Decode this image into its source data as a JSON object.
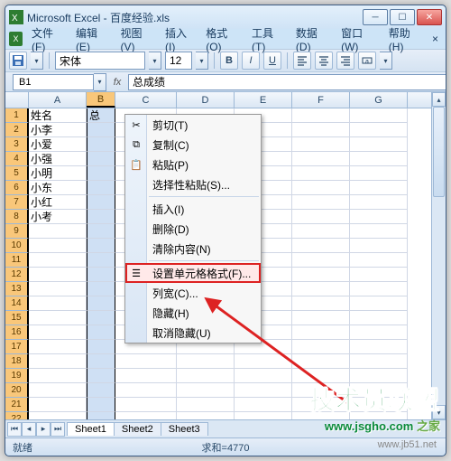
{
  "title": "Microsoft Excel - 百度经验.xls",
  "menus": {
    "file": "文件(F)",
    "edit": "编辑(E)",
    "view": "视图(V)",
    "insert": "插入(I)",
    "format": "格式(O)",
    "tools": "工具(T)",
    "data": "数据(D)",
    "window": "窗口(W)",
    "help": "帮助(H)"
  },
  "toolbar": {
    "font": "宋体",
    "size": "12"
  },
  "namebox": "B1",
  "formula": "总成绩",
  "columns": [
    "A",
    "B",
    "C",
    "D",
    "E",
    "F",
    "G"
  ],
  "rowcount": 23,
  "dataA": [
    "姓名",
    "小李",
    "小爱",
    "小强",
    "小明",
    "小东",
    "小红",
    "小考"
  ],
  "dataB_first": "总",
  "context": {
    "cut": "剪切(T)",
    "copy": "复制(C)",
    "paste": "粘贴(P)",
    "pasteSpecial": "选择性粘贴(S)...",
    "insert": "插入(I)",
    "delete": "删除(D)",
    "clear": "清除内容(N)",
    "formatCells": "设置单元格格式(F)...",
    "colWidth": "列宽(C)...",
    "hide": "隐藏(H)",
    "unhide": "取消隐藏(U)"
  },
  "sheets": [
    "Sheet1",
    "Sheet2",
    "Sheet3"
  ],
  "status": {
    "ready": "就绪",
    "sum": "求和=4770"
  },
  "watermark": {
    "brand": "技术员联盟",
    "url": "www.jsgho.com",
    "site": "之家",
    "src": "www.jb51.net"
  }
}
